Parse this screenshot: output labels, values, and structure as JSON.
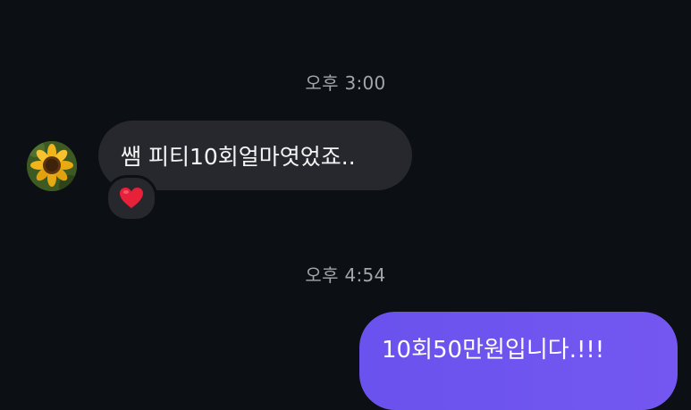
{
  "chat": {
    "messages": [
      {
        "timestamp": "오후 3:00",
        "text": "쌤 피티10회얼마엿었죠..",
        "reaction": "❤️",
        "direction": "incoming"
      },
      {
        "timestamp": "오후 4:54",
        "text": "10회50만원입니다.!!!",
        "direction": "outgoing"
      }
    ]
  },
  "colors": {
    "background": "#0c0f14",
    "incoming_bubble": "#26282d",
    "outgoing_bubble": "#6a52ee",
    "timestamp_text": "#a3a6ab"
  },
  "icons": {
    "avatar": "sunflower-avatar",
    "reaction": "heart-icon"
  }
}
